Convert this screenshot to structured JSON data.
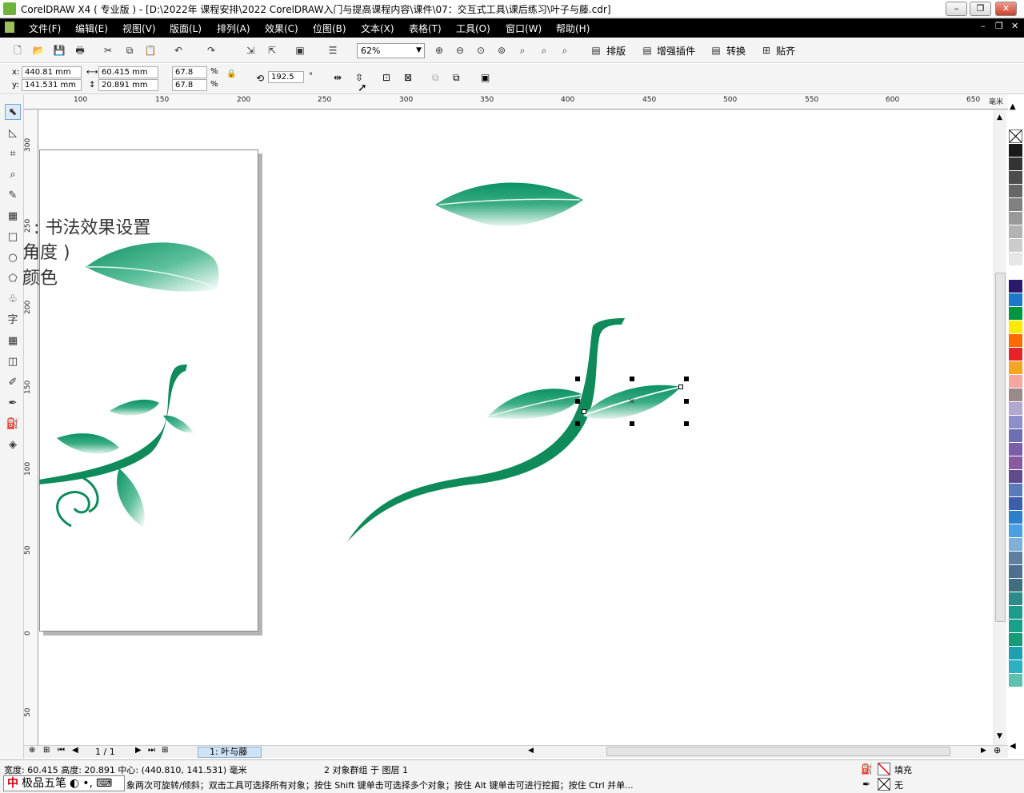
{
  "window": {
    "title": "CorelDRAW X4 ( 专业版 ) - [D:\\2022年 课程安排\\2022 CorelDRAW入门与提高课程内容\\课件\\07：交互式工具\\课后练习\\叶子与藤.cdr]"
  },
  "menubar": {
    "items": [
      "文件(F)",
      "编辑(E)",
      "视图(V)",
      "版面(L)",
      "排列(A)",
      "效果(C)",
      "位图(B)",
      "文本(X)",
      "表格(T)",
      "工具(O)",
      "窗口(W)",
      "帮助(H)"
    ]
  },
  "toolbar": {
    "zoom": "62%",
    "plugins": [
      "排版",
      "增强插件",
      "转换",
      "贴齐"
    ]
  },
  "propbar": {
    "x_label": "x:",
    "x": "440.81 mm",
    "y_label": "y:",
    "y": "141.531 mm",
    "w": "60.415 mm",
    "h": "20.891 mm",
    "scale_w": "67.8",
    "scale_h": "67.8",
    "pct": "%",
    "angle": "192.5",
    "deg": "°"
  },
  "ruler": {
    "h_ticks": [
      "100",
      "150",
      "200",
      "250",
      "300",
      "350",
      "400",
      "450",
      "500",
      "550",
      "600",
      "650"
    ],
    "h_unit": "毫米",
    "v_ticks": [
      "300",
      "250",
      "200",
      "150",
      "100",
      "50",
      "0",
      "50"
    ]
  },
  "document": {
    "lines": [
      ": 书法效果设置",
      "角度 )",
      "颜色"
    ]
  },
  "palette": {
    "colors": [
      "#1a1a1a",
      "#333333",
      "#4d4d4d",
      "#666666",
      "#808080",
      "#999999",
      "#b3b3b3",
      "#cccccc",
      "#e6e6e6",
      "#ffffff",
      "#2b1a6b",
      "#1f78c8",
      "#00963f",
      "#ffea00",
      "#ff6a00",
      "#e8232a",
      "#f5a623",
      "#f4a6a0",
      "#9a8a8a",
      "#b2a8d0",
      "#8e8ec8",
      "#6e6eb0",
      "#7b5ea8",
      "#8a5aa0",
      "#604c8c",
      "#5a7ab8",
      "#3c5fa8",
      "#2f80c8",
      "#4aa0e0",
      "#7fb0d8",
      "#5f7f9f",
      "#4f6f8f",
      "#3f6f7f",
      "#2f8a8a",
      "#1f9a8a",
      "#1aa08a",
      "#1b9a7a",
      "#1ea0b0",
      "#2fb0c0",
      "#60c0b0"
    ]
  },
  "pagebar": {
    "page_count": "1 / 1",
    "tab": "1: 叶与藤"
  },
  "status": {
    "dims": "宽度: 60.415  高度: 20.891  中心: (440.810, 141.531)  毫米",
    "selection": "2 对象群组 于 图层 1",
    "hint": "象两次可旋转/倾斜；双击工具可选择所有对象；按住 Shift 键单击可选择多个对象；按住 Alt 键单击可进行挖掘；按住 Ctrl 并单...",
    "fill_label": "填充",
    "outline_label": "无",
    "ime": "极品五笔"
  }
}
